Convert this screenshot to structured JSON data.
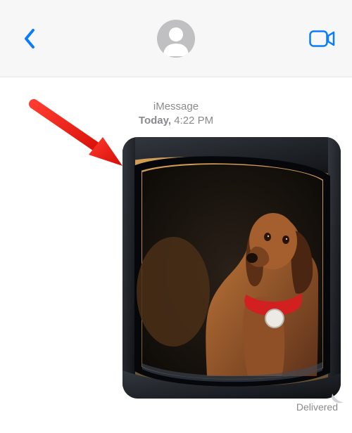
{
  "header": {
    "back_label": "Back",
    "facetime_label": "FaceTime Video",
    "avatar_label": "Contact avatar"
  },
  "thread": {
    "service": "iMessage",
    "date_prefix": "Today,",
    "time": "4:22 PM"
  },
  "message": {
    "description": "Photo of a brown dog with a red collar looking out of a car window",
    "status": "Delivered"
  },
  "annotation": {
    "type": "red-arrow",
    "points_to": "photo message corner"
  }
}
